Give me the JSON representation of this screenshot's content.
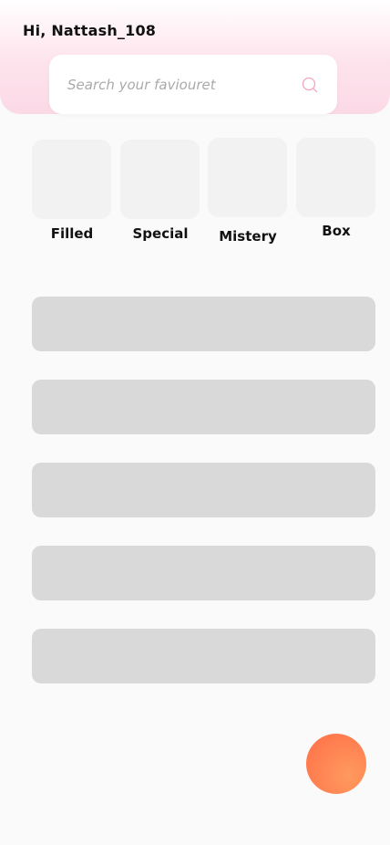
{
  "header": {
    "greeting": "Hi, Nattash_108"
  },
  "search": {
    "placeholder": "Search your faviouret",
    "icon": "search-icon",
    "icon_color": "#f3a6bd"
  },
  "categories": [
    {
      "label": "Filled"
    },
    {
      "label": "Special"
    },
    {
      "label": "Mistery"
    },
    {
      "label": "Box"
    }
  ],
  "list_items_count_visible": 5,
  "colors": {
    "header_gradient_start": "#ffffff",
    "header_gradient_end": "#fbd9e6",
    "fab": "#ff7b4e",
    "skeleton": "#d9d9d9",
    "tile": "#f2f2f2",
    "background": "#fafafa"
  },
  "fab": {
    "icon": "action-button"
  }
}
